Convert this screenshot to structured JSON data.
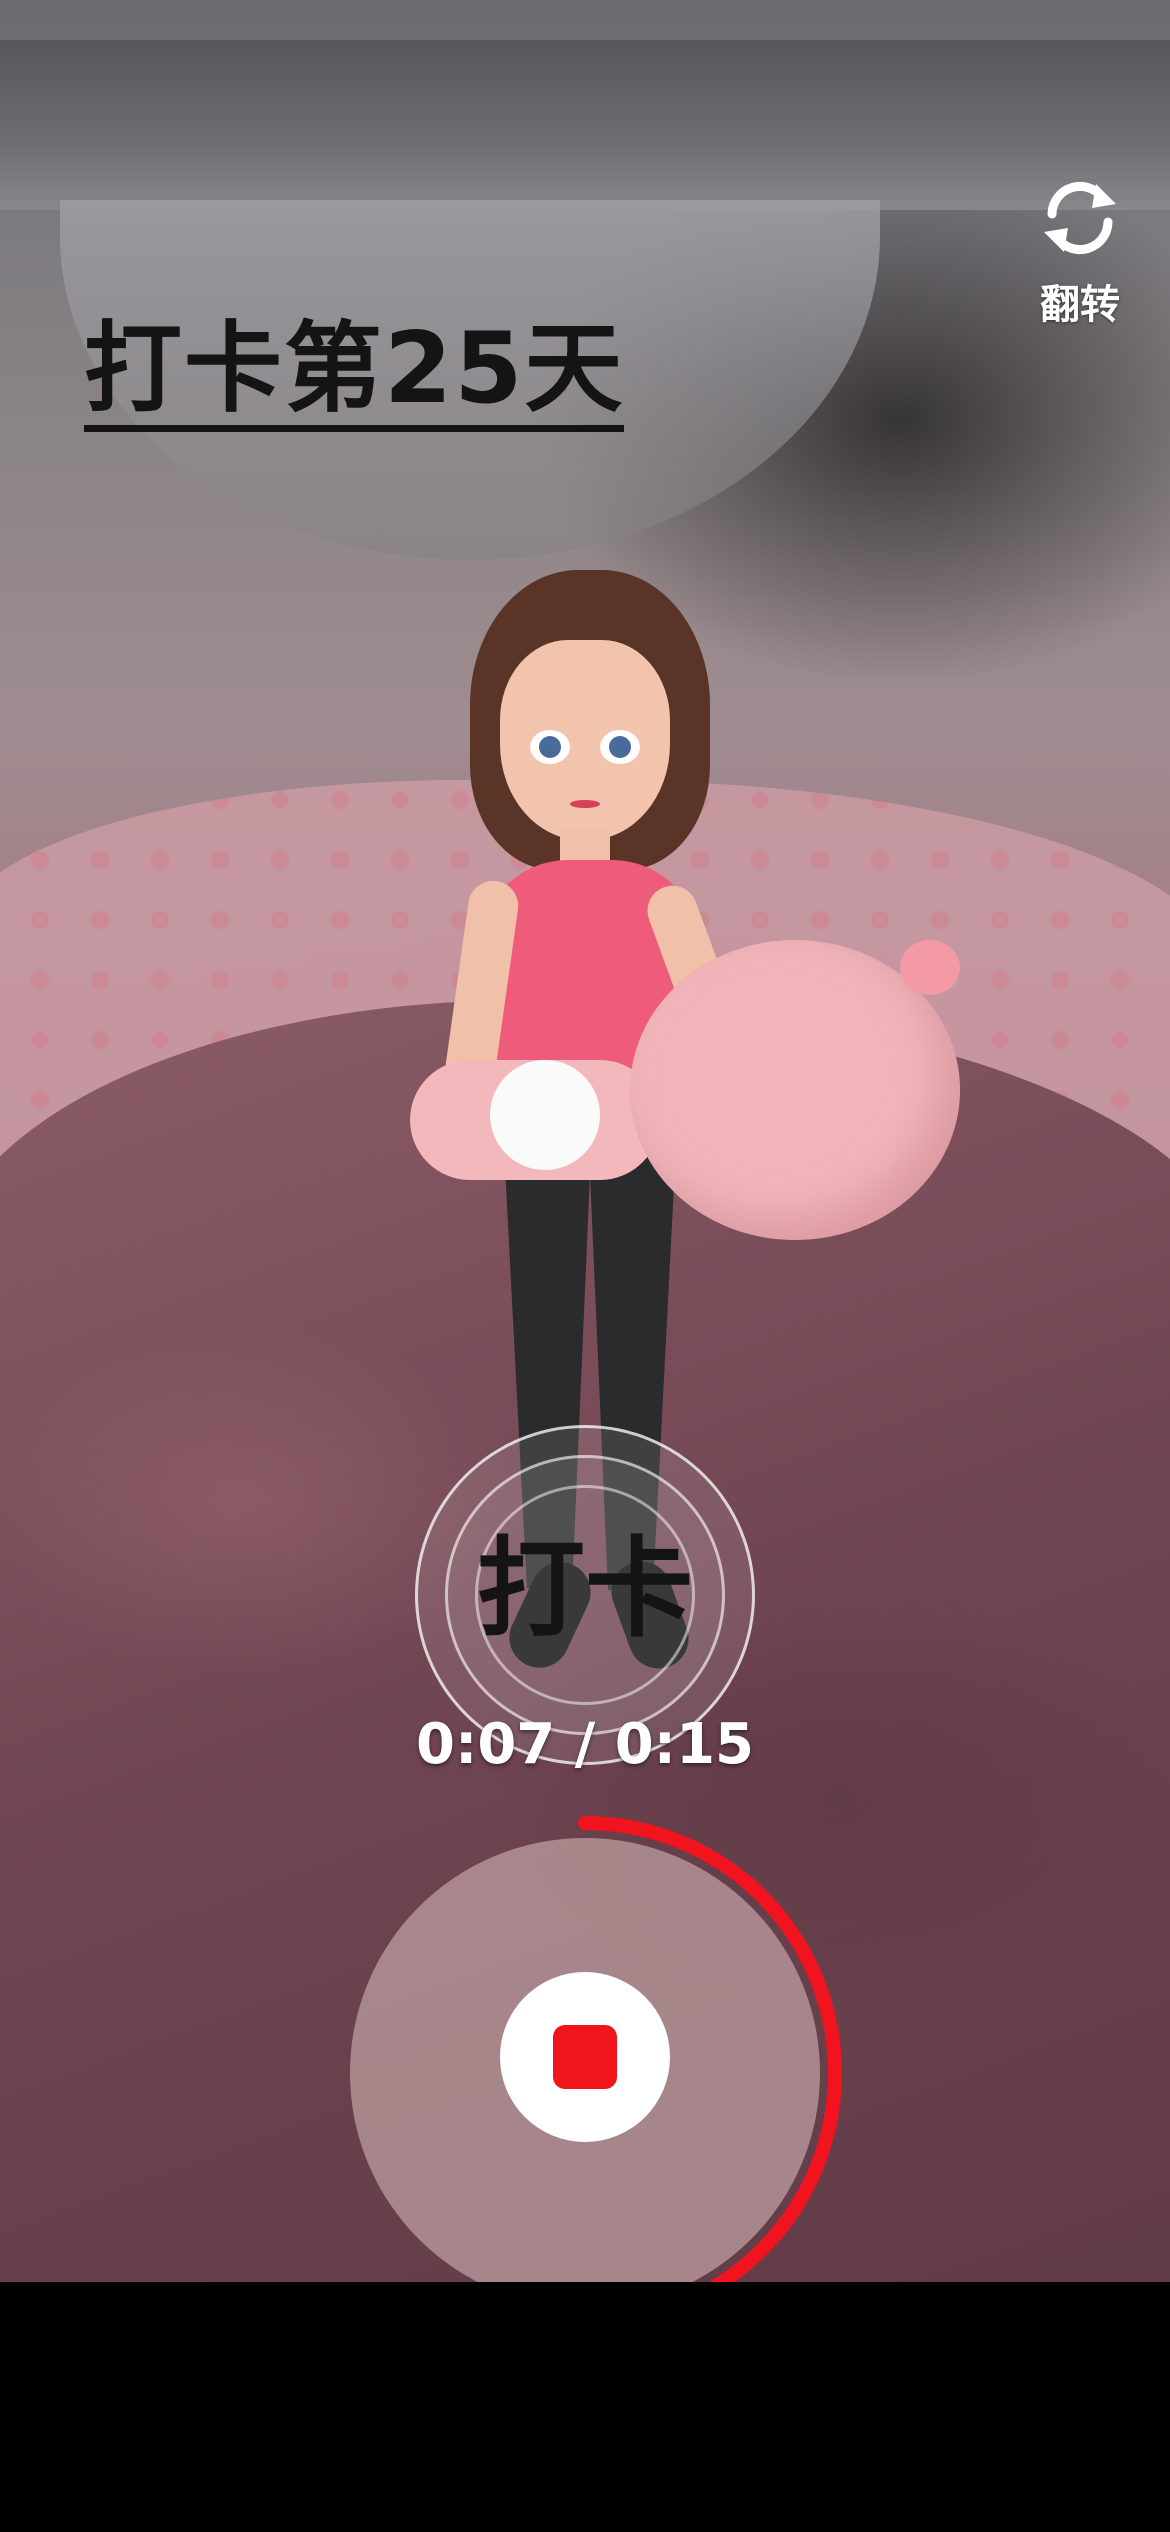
{
  "header": {
    "flip_label": "翻转",
    "flip_icon": "rotate-camera-icon",
    "title": "打卡第25天"
  },
  "checkin": {
    "label": "打卡"
  },
  "recording": {
    "elapsed": "0:07",
    "total": "0:15",
    "timer_text": "0:07 / 0:15",
    "progress": 0.4667,
    "stop_icon": "stop-icon"
  },
  "colors": {
    "record_red": "#f1141e",
    "title_text": "#141414",
    "white": "#ffffff"
  }
}
